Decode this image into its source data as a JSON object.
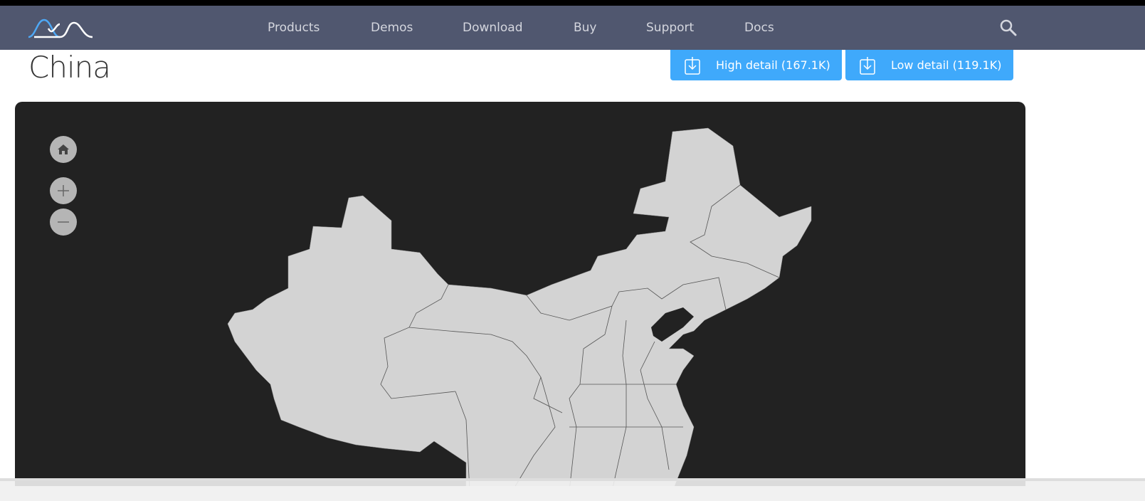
{
  "nav": {
    "items": [
      "Products",
      "Demos",
      "Download",
      "Buy",
      "Support",
      "Docs"
    ]
  },
  "page": {
    "title": "China"
  },
  "downloads": {
    "high": "High detail (167.1K)",
    "low": "Low detail (119.1K)"
  },
  "map": {
    "land_color": "#d3d3d3",
    "background": "#222222",
    "controls": [
      "home-icon",
      "zoom-in-icon",
      "zoom-out-icon"
    ]
  },
  "colors": {
    "nav": "#50576f",
    "accent": "#3fa9fb"
  }
}
